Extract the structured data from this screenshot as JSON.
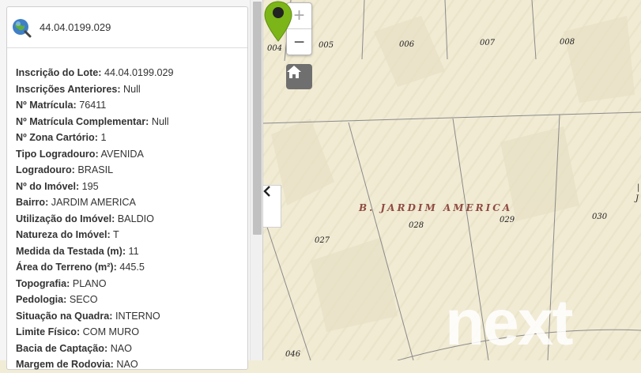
{
  "feature": {
    "title": "44.04.0199.029",
    "icon": "globe-icon",
    "attributes": [
      {
        "label": "Inscrição do Lote:",
        "value": "44.04.0199.029"
      },
      {
        "label": "Inscrições Anteriores:",
        "value": "Null"
      },
      {
        "label": "Nº Matrícula:",
        "value": "76411"
      },
      {
        "label": "Nº Matrícula Complementar:",
        "value": "Null"
      },
      {
        "label": "Nº Zona Cartório:",
        "value": "1"
      },
      {
        "label": "Tipo Logradouro:",
        "value": "AVENIDA"
      },
      {
        "label": "Logradouro:",
        "value": "BRASIL"
      },
      {
        "label": "Nº do Imóvel:",
        "value": "195"
      },
      {
        "label": "Bairro:",
        "value": "JARDIM AMERICA"
      },
      {
        "label": "Utilização do Imóvel:",
        "value": "BALDIO"
      },
      {
        "label": "Natureza do Imóvel:",
        "value": "T"
      },
      {
        "label": "Medida da Testada (m):",
        "value": "11"
      },
      {
        "label": "Área do Terreno (m²):",
        "value": "445.5"
      },
      {
        "label": "Topografia:",
        "value": "PLANO"
      },
      {
        "label": "Pedologia:",
        "value": "SECO"
      },
      {
        "label": "Situação na Quadra:",
        "value": "INTERNO"
      },
      {
        "label": "Limite Físico:",
        "value": "COM MURO"
      },
      {
        "label": "Bacia de Captação:",
        "value": "NAO"
      },
      {
        "label": "Margem de Rodovia:",
        "value": "NAO"
      }
    ]
  },
  "map": {
    "controls": {
      "zoom_in": "+",
      "zoom_out": "−",
      "home_icon": "home-icon",
      "collapse_icon": "chevron-left-icon"
    },
    "neighborhood_label": "B. JARDIM AMERICA",
    "lot_labels": [
      "004",
      "005",
      "006",
      "007",
      "008",
      "027",
      "028",
      "029",
      "030",
      "046"
    ],
    "partial_label": "J",
    "edge_mark": "|",
    "marker": {
      "icon": "map-pin-icon",
      "color": "#7cb518"
    },
    "watermark": "next"
  }
}
